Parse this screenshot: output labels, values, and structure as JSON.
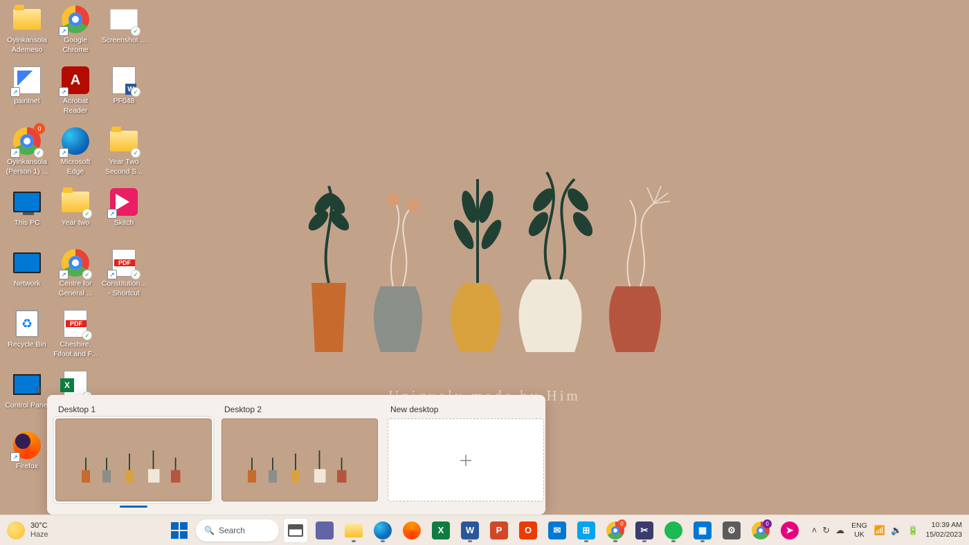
{
  "wallpaper": {
    "caption": "Uniquely made by Him"
  },
  "desktop_icons": [
    {
      "id": "user-folder",
      "label": "Oyinkansola Ademeso",
      "kind": "folder",
      "col": 0,
      "row": 0
    },
    {
      "id": "google-chrome",
      "label": "Google Chrome",
      "kind": "chrome",
      "col": 1,
      "row": 0,
      "shortcut": true
    },
    {
      "id": "screenshot",
      "label": "Screenshot ...",
      "kind": "screenshot",
      "col": 2,
      "row": 0,
      "sync": true
    },
    {
      "id": "paintnet",
      "label": "paintnet",
      "kind": "paint",
      "col": 0,
      "row": 1,
      "shortcut": true
    },
    {
      "id": "acrobat",
      "label": "Acrobat Reader",
      "kind": "acrobat",
      "col": 1,
      "row": 1,
      "shortcut": true
    },
    {
      "id": "pf048",
      "label": "PF048",
      "kind": "worddoc",
      "col": 2,
      "row": 1,
      "sync": true
    },
    {
      "id": "chrome-person",
      "label": "Oyinkansola (Person 1) ...",
      "kind": "chrome",
      "col": 0,
      "row": 2,
      "shortcut": true,
      "sync": true,
      "badge": "0"
    },
    {
      "id": "ms-edge",
      "label": "Microsoft Edge",
      "kind": "edge",
      "col": 1,
      "row": 2,
      "shortcut": true
    },
    {
      "id": "year-two-second",
      "label": "Year Two Second S...",
      "kind": "folder",
      "col": 2,
      "row": 2,
      "sync": true
    },
    {
      "id": "this-pc",
      "label": "This PC",
      "kind": "thispc",
      "col": 0,
      "row": 3
    },
    {
      "id": "year-two",
      "label": "Year two",
      "kind": "folder",
      "col": 1,
      "row": 3,
      "sync": true
    },
    {
      "id": "skitch",
      "label": "Skitch",
      "kind": "skitch",
      "col": 2,
      "row": 3,
      "shortcut": true
    },
    {
      "id": "network",
      "label": "Network",
      "kind": "network",
      "col": 0,
      "row": 4
    },
    {
      "id": "centre-for-general",
      "label": "Centre for General ...",
      "kind": "chrome",
      "col": 1,
      "row": 4,
      "shortcut": true,
      "sync": true
    },
    {
      "id": "constitution",
      "label": "Constitution... - Shortcut",
      "kind": "pdf",
      "col": 2,
      "row": 4,
      "shortcut": true,
      "sync": true
    },
    {
      "id": "recycle-bin",
      "label": "Recycle Bin",
      "kind": "recycle",
      "col": 0,
      "row": 5
    },
    {
      "id": "cheshire",
      "label": "Cheshire, Fifoot and F...",
      "kind": "pdf",
      "col": 1,
      "row": 5,
      "sync": true
    },
    {
      "id": "control-panel",
      "label": "Control Panel",
      "kind": "cpanel",
      "col": 0,
      "row": 6
    },
    {
      "id": "excel-file",
      "label": "",
      "kind": "excel",
      "col": 1,
      "row": 6,
      "sync": true
    },
    {
      "id": "firefox",
      "label": "Firefox",
      "kind": "firefox",
      "col": 0,
      "row": 7,
      "shortcut": true
    }
  ],
  "taskview": {
    "desktops": [
      {
        "name": "Desktop 1",
        "active": true
      },
      {
        "name": "Desktop 2",
        "active": false
      }
    ],
    "new_label": "New desktop"
  },
  "taskbar": {
    "weather": {
      "temp": "30°C",
      "condition": "Haze"
    },
    "search_placeholder": "Search",
    "pinned": [
      {
        "id": "start",
        "name": "start-button",
        "glyph": "start"
      },
      {
        "id": "search",
        "name": "search-box",
        "glyph": "search"
      },
      {
        "id": "taskview",
        "name": "task-view-button",
        "glyph": "taskview",
        "active": true
      },
      {
        "id": "teams",
        "name": "teams-chat",
        "glyph": "g-teams",
        "running": false
      },
      {
        "id": "explorer",
        "name": "file-explorer",
        "glyph": "g-folder",
        "running": true
      },
      {
        "id": "edge",
        "name": "microsoft-edge",
        "glyph": "g-edge",
        "running": true
      },
      {
        "id": "firefox",
        "name": "firefox",
        "glyph": "g-ff",
        "running": false
      },
      {
        "id": "excel",
        "name": "excel",
        "glyph": "g-excel",
        "running": false,
        "text": "X"
      },
      {
        "id": "word",
        "name": "word",
        "glyph": "g-word",
        "running": true,
        "text": "W"
      },
      {
        "id": "powerpoint",
        "name": "powerpoint",
        "glyph": "g-ppt",
        "running": false,
        "text": "P"
      },
      {
        "id": "office",
        "name": "office",
        "glyph": "g-office",
        "running": false,
        "text": "O"
      },
      {
        "id": "mail",
        "name": "mail",
        "glyph": "g-mail",
        "running": false,
        "text": "✉"
      },
      {
        "id": "store",
        "name": "microsoft-store",
        "glyph": "g-store",
        "running": true,
        "text": "⊞"
      },
      {
        "id": "chrome",
        "name": "google-chrome",
        "glyph": "g-chrome",
        "running": true,
        "badge": "0",
        "badgeColor": "#f25022"
      },
      {
        "id": "snip",
        "name": "snipping-tool",
        "glyph": "g-snip",
        "running": true,
        "text": "✂"
      },
      {
        "id": "spotify",
        "name": "spotify",
        "glyph": "g-spotify",
        "running": true
      },
      {
        "id": "browser",
        "name": "browser",
        "glyph": "g-browser",
        "running": true,
        "text": "▦"
      },
      {
        "id": "settings",
        "name": "settings",
        "glyph": "g-settings",
        "running": false,
        "text": "⚙"
      },
      {
        "id": "chrome2",
        "name": "chrome-profile",
        "glyph": "g-chrome",
        "running": false,
        "badge": "0",
        "badgeColor": "#7b1fa2"
      },
      {
        "id": "pink",
        "name": "app-pink",
        "glyph": "g-pink",
        "running": false,
        "text": "➤"
      }
    ],
    "tray": {
      "chevron": "˄",
      "sync": "↻",
      "onedrive": "☁",
      "lang_top": "ENG",
      "lang_bottom": "UK",
      "wifi": "📶",
      "volume": "🔉",
      "battery": "🔋",
      "time": "10:39 AM",
      "date": "15/02/2023"
    }
  }
}
